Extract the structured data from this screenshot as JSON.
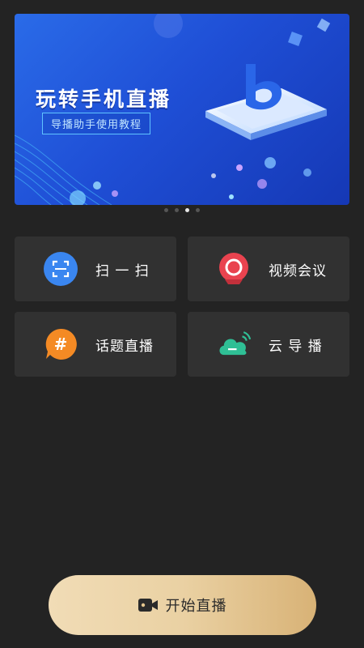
{
  "banner": {
    "title": "玩转手机直播",
    "subtitle": "导播助手使用教程",
    "pages": 4,
    "active_page": 2
  },
  "tiles": [
    {
      "label": "扫 一 扫",
      "icon": "scan-icon",
      "color": "#3a86f0"
    },
    {
      "label": "视频会议",
      "icon": "video-camera-icon",
      "color": "#e9434f"
    },
    {
      "label": "话题直播",
      "icon": "hashtag-icon",
      "color": "#f48a24"
    },
    {
      "label": "云 导 播",
      "icon": "cloud-icon",
      "color": "#2fbf95"
    }
  ],
  "start_button": {
    "label": "开始直播",
    "icon": "camera-icon"
  }
}
